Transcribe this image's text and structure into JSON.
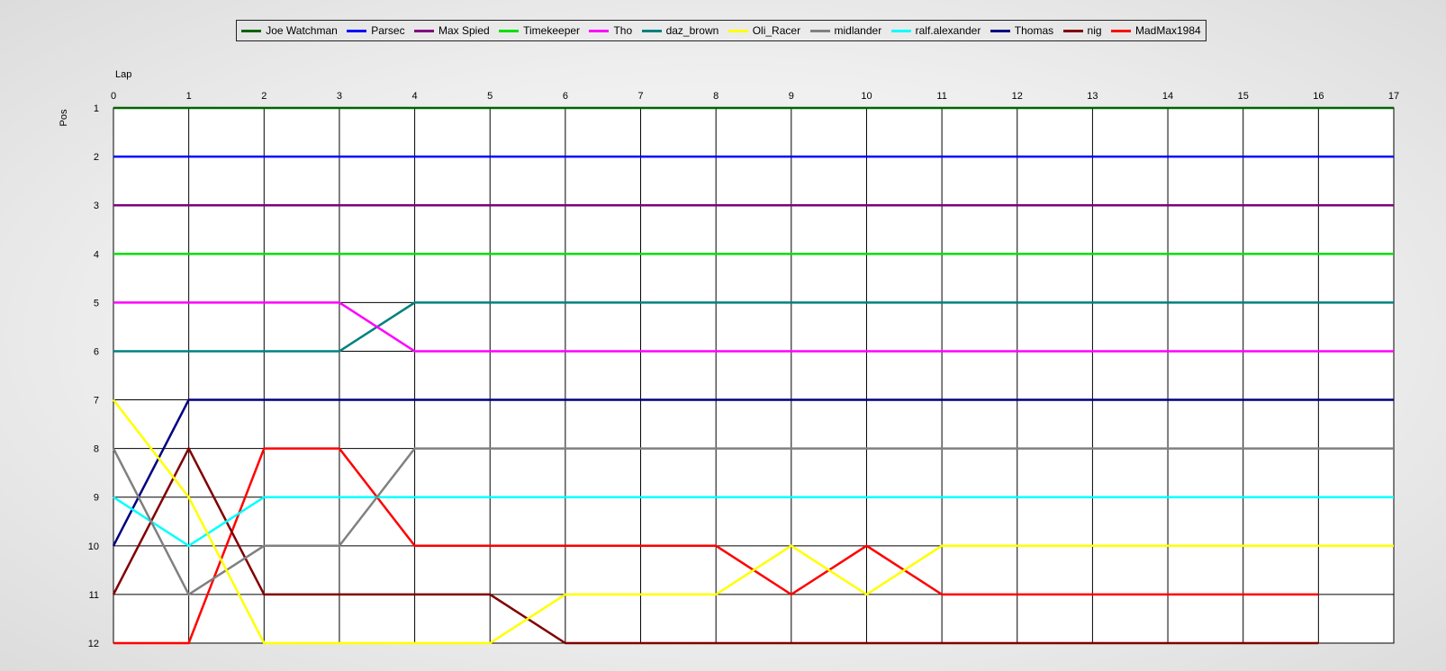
{
  "chart_data": {
    "type": "line",
    "xlabel": "Lap",
    "ylabel": "Pos",
    "xlim": [
      0,
      17
    ],
    "ylim": [
      1,
      12
    ],
    "x_ticks": [
      0,
      1,
      2,
      3,
      4,
      5,
      6,
      7,
      8,
      9,
      10,
      11,
      12,
      13,
      14,
      15,
      16,
      17
    ],
    "y_ticks": [
      1,
      2,
      3,
      4,
      5,
      6,
      7,
      8,
      9,
      10,
      11,
      12
    ],
    "y_inverted": true,
    "grid": true,
    "legend_position": "top",
    "series": [
      {
        "name": "Joe Watchman",
        "color": "#006400",
        "x": [
          0,
          1,
          2,
          3,
          4,
          5,
          6,
          7,
          8,
          9,
          10,
          11,
          12,
          13,
          14,
          15,
          16,
          17
        ],
        "values": [
          1,
          1,
          1,
          1,
          1,
          1,
          1,
          1,
          1,
          1,
          1,
          1,
          1,
          1,
          1,
          1,
          1,
          1
        ]
      },
      {
        "name": "Parsec",
        "color": "#0000FF",
        "x": [
          0,
          1,
          2,
          3,
          4,
          5,
          6,
          7,
          8,
          9,
          10,
          11,
          12,
          13,
          14,
          15,
          16,
          17
        ],
        "values": [
          2,
          2,
          2,
          2,
          2,
          2,
          2,
          2,
          2,
          2,
          2,
          2,
          2,
          2,
          2,
          2,
          2,
          2
        ]
      },
      {
        "name": "Max Spied",
        "color": "#800080",
        "x": [
          0,
          1,
          2,
          3,
          4,
          5,
          6,
          7,
          8,
          9,
          10,
          11,
          12,
          13,
          14,
          15,
          16,
          17
        ],
        "values": [
          3,
          3,
          3,
          3,
          3,
          3,
          3,
          3,
          3,
          3,
          3,
          3,
          3,
          3,
          3,
          3,
          3,
          3
        ]
      },
      {
        "name": "Timekeeper",
        "color": "#00E000",
        "x": [
          0,
          1,
          2,
          3,
          4,
          5,
          6,
          7,
          8,
          9,
          10,
          11,
          12,
          13,
          14,
          15,
          16,
          17
        ],
        "values": [
          4,
          4,
          4,
          4,
          4,
          4,
          4,
          4,
          4,
          4,
          4,
          4,
          4,
          4,
          4,
          4,
          4,
          4
        ]
      },
      {
        "name": "Tho",
        "color": "#FF00FF",
        "x": [
          0,
          1,
          2,
          3,
          4,
          5,
          6,
          7,
          8,
          9,
          10,
          11,
          12,
          13,
          14,
          15,
          16,
          17
        ],
        "values": [
          5,
          5,
          5,
          5,
          6,
          6,
          6,
          6,
          6,
          6,
          6,
          6,
          6,
          6,
          6,
          6,
          6,
          6
        ]
      },
      {
        "name": "daz_brown",
        "color": "#008080",
        "x": [
          0,
          1,
          2,
          3,
          4,
          5,
          6,
          7,
          8,
          9,
          10,
          11,
          12,
          13,
          14,
          15,
          16,
          17
        ],
        "values": [
          6,
          6,
          6,
          6,
          5,
          5,
          5,
          5,
          5,
          5,
          5,
          5,
          5,
          5,
          5,
          5,
          5,
          5
        ]
      },
      {
        "name": "Oli_Racer",
        "color": "#FFFF00",
        "x": [
          0,
          1,
          2,
          3,
          4,
          5,
          6,
          7,
          8,
          9,
          10,
          11,
          12,
          13,
          14,
          15,
          16,
          17
        ],
        "values": [
          7,
          9,
          12,
          12,
          12,
          12,
          11,
          11,
          11,
          10,
          11,
          10,
          10,
          10,
          10,
          10,
          10,
          10
        ]
      },
      {
        "name": "midlander",
        "color": "#808080",
        "x": [
          0,
          1,
          2,
          3,
          4,
          5,
          6,
          7,
          8,
          9,
          10,
          11,
          12,
          13,
          14,
          15,
          16,
          17
        ],
        "values": [
          8,
          11,
          10,
          10,
          8,
          8,
          8,
          8,
          8,
          8,
          8,
          8,
          8,
          8,
          8,
          8,
          8,
          8
        ]
      },
      {
        "name": "ralf.alexander",
        "color": "#00FFFF",
        "x": [
          0,
          1,
          2,
          3,
          4,
          5,
          6,
          7,
          8,
          9,
          10,
          11,
          12,
          13,
          14,
          15,
          16,
          17
        ],
        "values": [
          9,
          10,
          9,
          9,
          9,
          9,
          9,
          9,
          9,
          9,
          9,
          9,
          9,
          9,
          9,
          9,
          9,
          9
        ]
      },
      {
        "name": "Thomas",
        "color": "#000080",
        "x": [
          0,
          1,
          2,
          3,
          4,
          5,
          6,
          7,
          8,
          9,
          10,
          11,
          12,
          13,
          14,
          15,
          16,
          17
        ],
        "values": [
          10,
          7,
          7,
          7,
          7,
          7,
          7,
          7,
          7,
          7,
          7,
          7,
          7,
          7,
          7,
          7,
          7,
          7
        ]
      },
      {
        "name": "nig",
        "color": "#800000",
        "x": [
          0,
          1,
          2,
          3,
          4,
          5,
          6,
          7,
          8,
          9,
          10,
          11,
          12,
          13,
          14,
          15,
          16
        ],
        "values": [
          11,
          8,
          11,
          11,
          11,
          11,
          12,
          12,
          12,
          12,
          12,
          12,
          12,
          12,
          12,
          12,
          12
        ]
      },
      {
        "name": "MadMax1984",
        "color": "#FF0000",
        "x": [
          0,
          1,
          2,
          3,
          4,
          5,
          6,
          7,
          8,
          9,
          10,
          11,
          12,
          13,
          14,
          15,
          16
        ],
        "values": [
          12,
          12,
          8,
          8,
          10,
          10,
          10,
          10,
          10,
          11,
          10,
          11,
          11,
          11,
          11,
          11,
          11
        ]
      }
    ]
  }
}
